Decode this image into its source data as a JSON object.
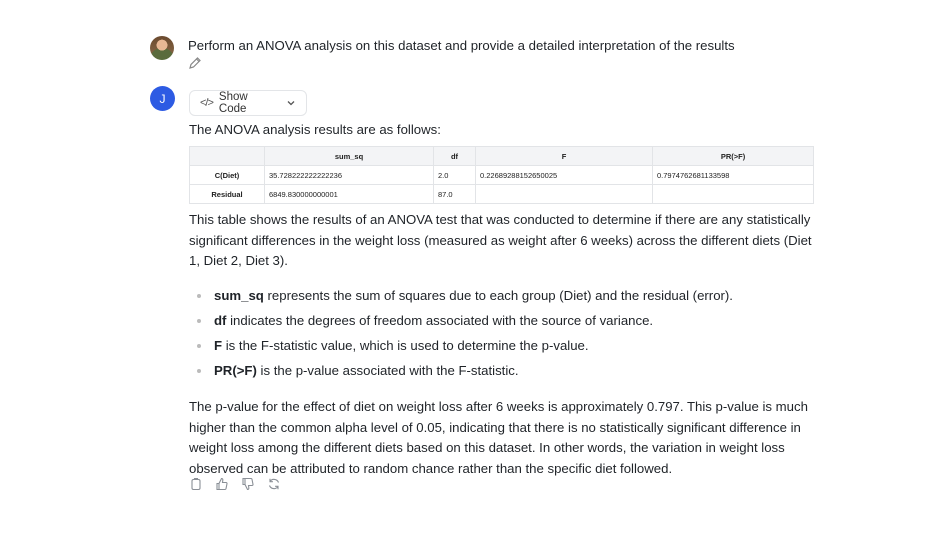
{
  "user_message": {
    "text": "Perform an ANOVA analysis on this dataset and provide a detailed interpretation of the results"
  },
  "assistant": {
    "avatar_letter": "J",
    "show_code_label": "Show Code",
    "intro": "The ANOVA analysis results are as follows:",
    "table": {
      "headers": [
        "",
        "sum_sq",
        "df",
        "F",
        "PR(>F)"
      ],
      "rows": [
        {
          "label": "C(Diet)",
          "sum_sq": "35.728222222222236",
          "df": "2.0",
          "F": "0.22689288152650025",
          "PR": "0.7974762681133598"
        },
        {
          "label": "Residual",
          "sum_sq": "6849.830000000001",
          "df": "87.0",
          "F": "",
          "PR": ""
        }
      ]
    },
    "paragraph1": "This table shows the results of an ANOVA test that was conducted to determine if there are any statistically significant differences in the weight loss (measured as weight after 6 weeks) across the different diets (Diet 1, Diet 2, Diet 3).",
    "bullets": [
      {
        "term": "sum_sq",
        "text": " represents the sum of squares due to each group (Diet) and the residual (error)."
      },
      {
        "term": "df",
        "text": " indicates the degrees of freedom associated with the source of variance."
      },
      {
        "term": "F",
        "text": " is the F-statistic value, which is used to determine the p-value."
      },
      {
        "term": "PR(>F)",
        "text": " is the p-value associated with the F-statistic."
      }
    ],
    "paragraph2": "The p-value for the effect of diet on weight loss after 6 weeks is approximately 0.797. This p-value is much higher than the common alpha level of 0.05, indicating that there is no statistically significant difference in weight loss among the different diets based on this dataset. In other words, the variation in weight loss observed can be attributed to random chance rather than the specific diet followed."
  },
  "icons": {
    "edit": "pencil-icon",
    "code": "code-icon",
    "chevron": "chevron-down-icon",
    "copy": "copy-icon",
    "like": "thumbs-up-icon",
    "dislike": "thumbs-down-icon",
    "regenerate": "refresh-icon"
  },
  "colors": {
    "accent": "#2d5be3",
    "table_header_bg": "#f3f4f6",
    "icon_gray": "#8a8f96"
  }
}
